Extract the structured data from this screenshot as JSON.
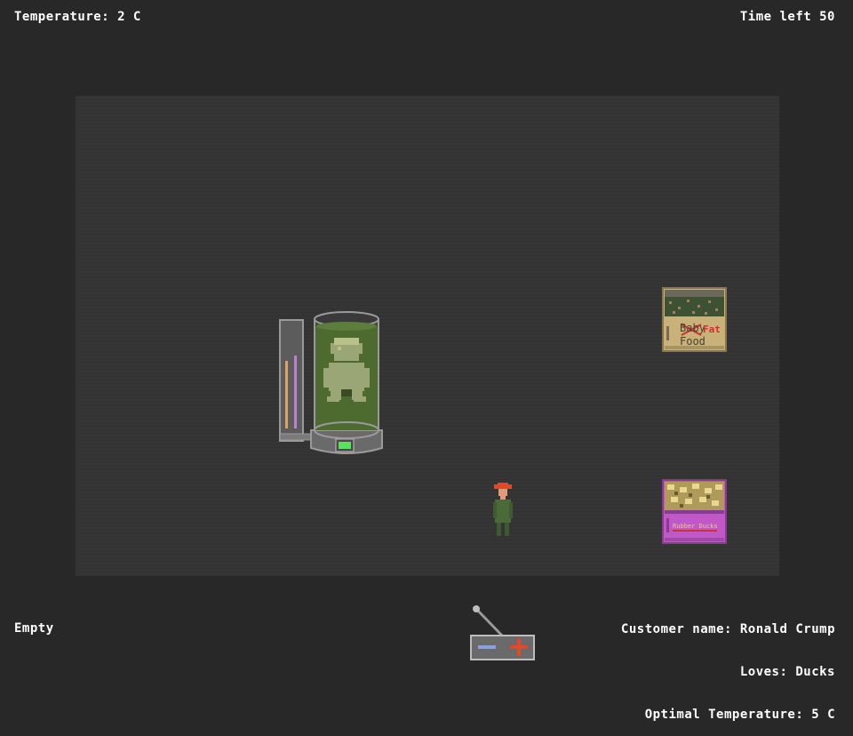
{
  "hud": {
    "temperature": "Temperature: 2 C",
    "time_left": "Time left 50",
    "held_item": "Empty",
    "customer_name": "Customer name: Ronald Crump",
    "loves": "Loves: Ducks",
    "optimal_temperature": "Optimal Temperature: 5 C"
  },
  "items": {
    "food_crate": {
      "label_crossed": "Baby",
      "label_overwrite": "Fat",
      "label": "Food"
    },
    "duck_crate": {
      "label": "Rubber Ducks"
    }
  },
  "colors": {
    "background": "#282828",
    "room_floor": "#353535",
    "tank_liquid": "#4d6b2f",
    "food_crate": "#c8b27a",
    "duck_crate": "#c058c8",
    "player_hat": "#e04a2a",
    "player_body": "#4a6a3a",
    "lever_plus": "#e04a2a",
    "lever_minus": "#8aa0e0"
  },
  "icons": {
    "tank": "cloning-tank-icon",
    "player": "player-character-icon",
    "lever": "temperature-lever-icon"
  }
}
